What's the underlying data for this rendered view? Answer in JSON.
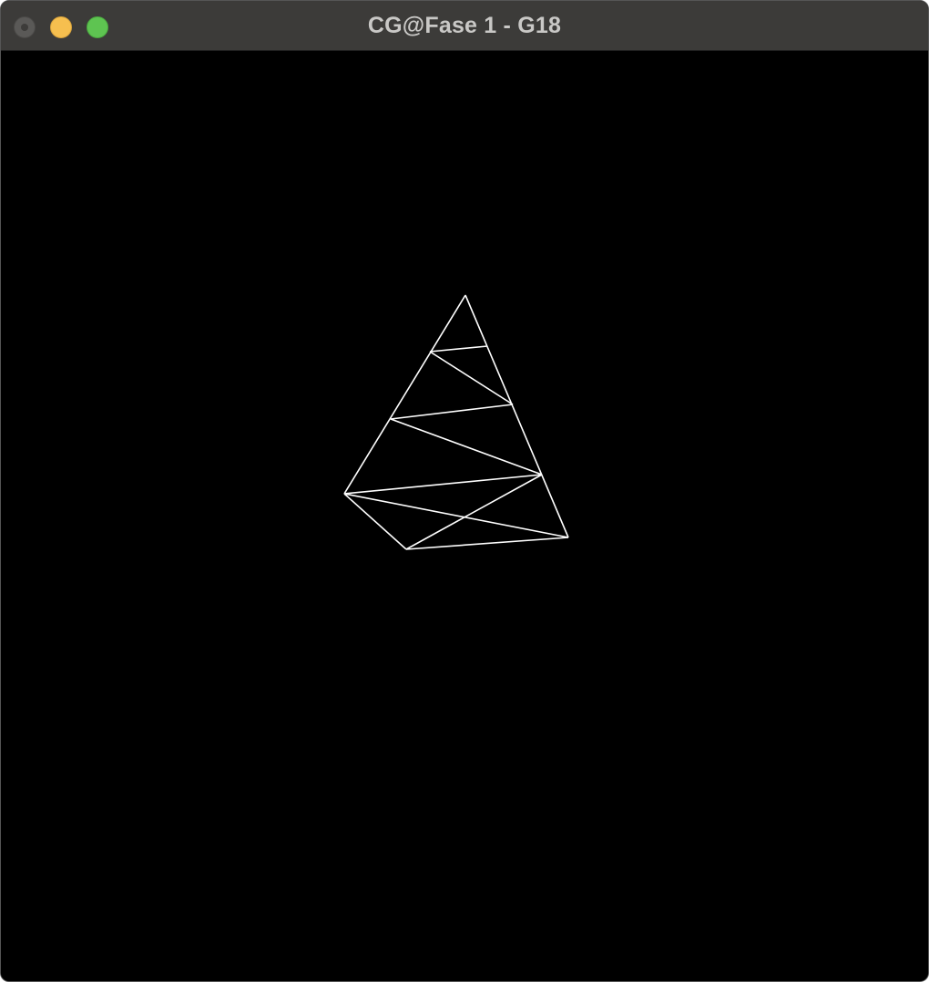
{
  "window": {
    "title": "CG@Fase 1 - G18",
    "controls": {
      "close": {
        "icon": "close-icon",
        "color": "#5a5957"
      },
      "minimize": {
        "icon": "minimize-icon",
        "color": "#f6bf4f"
      },
      "zoom": {
        "icon": "zoom-icon",
        "color": "#5ec451"
      }
    },
    "titlebar_color": "#3c3b39"
  },
  "scene": {
    "background": "#000000",
    "wireframe_color": "#ffffff",
    "model": "cone",
    "render_mode": "wireframe"
  }
}
